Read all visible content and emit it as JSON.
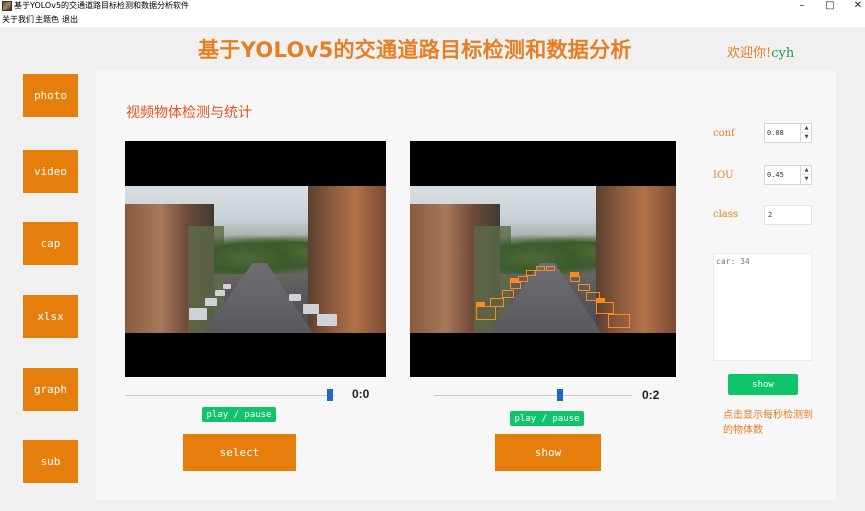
{
  "window": {
    "title": "基于YOLOv5的交通道路目标检测和数据分析软件",
    "controls": {
      "minimize": "–",
      "maximize": "□",
      "close": "✕"
    }
  },
  "menu": [
    "关于我们",
    "主题色",
    "退出"
  ],
  "header": {
    "title": "基于YOLOv5的交通道路目标检测和数据分析",
    "welcome_prefix": "欢迎你!",
    "welcome_user": "cyh"
  },
  "sidebar": {
    "items": [
      {
        "label": "photo"
      },
      {
        "label": "video"
      },
      {
        "label": "cap"
      },
      {
        "label": "xlsx"
      },
      {
        "label": "graph"
      },
      {
        "label": "sub"
      }
    ]
  },
  "main": {
    "section_title": "视频物体检测与统计",
    "left_player": {
      "time": "0:0",
      "play_label": "play / pause",
      "action_label": "select",
      "progress_fraction": 0.99
    },
    "right_player": {
      "time": "0:2",
      "play_label": "play / pause",
      "action_label": "show",
      "progress_fraction": 0.64
    }
  },
  "params": {
    "conf_label": "conf",
    "conf_value": "0.08",
    "iou_label": "IOU",
    "iou_value": "0.45",
    "class_label": "class",
    "class_value": "2"
  },
  "stats": {
    "text": "car: 34",
    "show_label": "show",
    "hint": "点击显示每秒检测到的物体数"
  },
  "colors": {
    "accent_orange": "#e67e0c",
    "title_orange": "#e67e22",
    "green": "#10c46a",
    "slider_blue": "#1b6ac9"
  }
}
